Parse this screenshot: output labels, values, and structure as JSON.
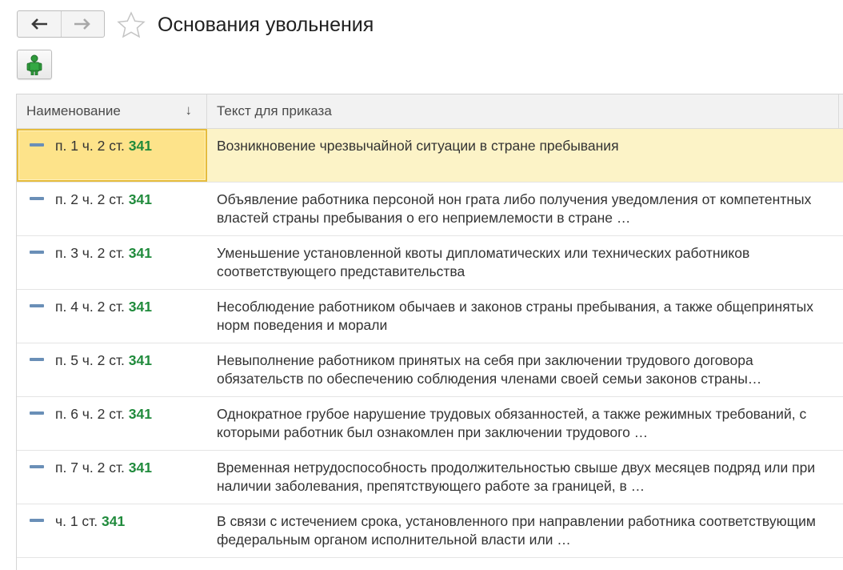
{
  "window": {
    "title": "Основания увольнения"
  },
  "icons": {
    "back": "arrow-left-icon",
    "forward": "arrow-right-icon",
    "favorite": "star-icon",
    "tool": "user-green-icon",
    "row_marker": "element-dash-icon"
  },
  "colors": {
    "accent_green": "#1f8a3b",
    "selection": "#fde38a",
    "selection_row": "#fcf3c7"
  },
  "table": {
    "columns": [
      {
        "label": "Наименование",
        "sort": "↓"
      },
      {
        "label": "Текст для приказа"
      }
    ],
    "rows": [
      {
        "code_prefix": "п. 1 ч. 2 ст. ",
        "code_num": "341",
        "text": "Возникновение чрезвычайной ситуации в стране пребывания"
      },
      {
        "code_prefix": "п. 2 ч. 2 ст. ",
        "code_num": "341",
        "text": "Объявление работника персоной нон грата либо получения уведомления от компетентных властей страны пребывания о его неприемлемости в стране …"
      },
      {
        "code_prefix": "п. 3 ч. 2 ст. ",
        "code_num": "341",
        "text": "Уменьшение установленной квоты дипломатических или технических работников соответствующего представительства"
      },
      {
        "code_prefix": "п. 4 ч. 2 ст. ",
        "code_num": "341",
        "text": "Несоблюдение работником обычаев и законов страны пребывания, а также общепринятых норм поведения и морали"
      },
      {
        "code_prefix": "п. 5 ч. 2 ст. ",
        "code_num": "341",
        "text": "Невыполнение работником принятых на себя при заключении трудового договора обязательств по обеспечению соблюдения членами своей семьи законов страны…"
      },
      {
        "code_prefix": "п. 6 ч. 2 ст. ",
        "code_num": "341",
        "text": "Однократное грубое нарушение трудовых обязанностей, а также режимных требований, с которыми работник был ознакомлен при заключении трудового …"
      },
      {
        "code_prefix": "п. 7 ч. 2 ст. ",
        "code_num": "341",
        "text": "Временная нетрудоспособность продолжительностью свыше двух месяцев подряд или при наличии заболевания, препятствующего работе за границей, в …"
      },
      {
        "code_prefix": "ч. 1 ст. ",
        "code_num": "341",
        "text": "В связи с истечением срока, установленного при направлении работника соответствующим федеральным органом исполнительной власти или …"
      }
    ]
  }
}
